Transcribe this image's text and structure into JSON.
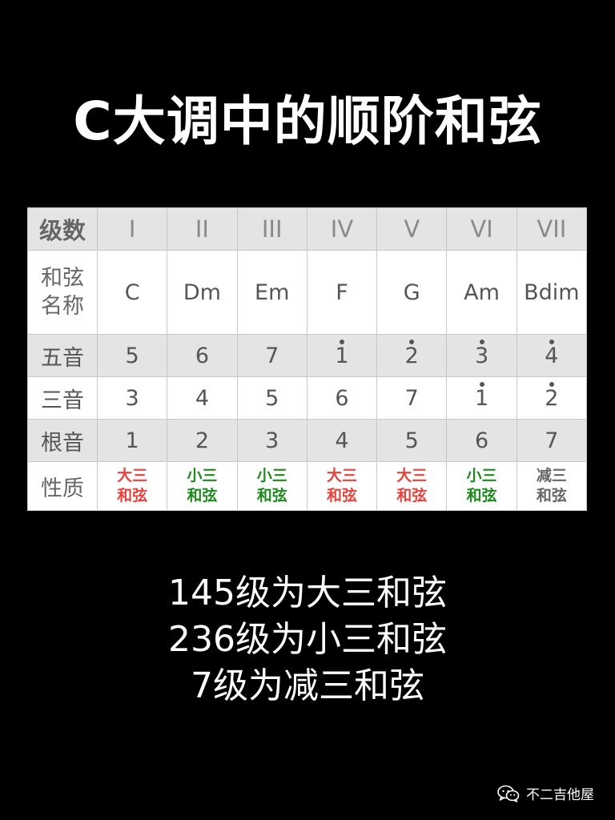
{
  "title": "C大调中的顺阶和弦",
  "table": {
    "header_label": "级数",
    "degrees": [
      "I",
      "II",
      "III",
      "IV",
      "V",
      "VI",
      "VII"
    ],
    "chord_name_label_line1": "和弦",
    "chord_name_label_line2": "名称",
    "chord_names": [
      "C",
      "Dm",
      "Em",
      "F",
      "G",
      "Am",
      "Bdim"
    ],
    "fifth_label": "五音",
    "fifths": [
      {
        "value": "5",
        "high": false
      },
      {
        "value": "6",
        "high": false
      },
      {
        "value": "7",
        "high": false
      },
      {
        "value": "1",
        "high": true
      },
      {
        "value": "2",
        "high": true
      },
      {
        "value": "3",
        "high": true
      },
      {
        "value": "4",
        "high": true
      }
    ],
    "third_label": "三音",
    "thirds": [
      {
        "value": "3",
        "high": false
      },
      {
        "value": "4",
        "high": false
      },
      {
        "value": "5",
        "high": false
      },
      {
        "value": "6",
        "high": false
      },
      {
        "value": "7",
        "high": false
      },
      {
        "value": "1",
        "high": true
      },
      {
        "value": "2",
        "high": true
      }
    ],
    "root_label": "根音",
    "roots": [
      "1",
      "2",
      "3",
      "4",
      "5",
      "6",
      "7"
    ],
    "quality_label": "性质",
    "qualities": [
      {
        "line1": "大三",
        "line2": "和弦",
        "color": "#e8423c"
      },
      {
        "line1": "小三",
        "line2": "和弦",
        "color": "#1e8a1e"
      },
      {
        "line1": "小三",
        "line2": "和弦",
        "color": "#1e8a1e"
      },
      {
        "line1": "大三",
        "line2": "和弦",
        "color": "#e8423c"
      },
      {
        "line1": "大三",
        "line2": "和弦",
        "color": "#e8423c"
      },
      {
        "line1": "小三",
        "line2": "和弦",
        "color": "#1e8a1e"
      },
      {
        "line1": "减三",
        "line2": "和弦",
        "color": "#666666"
      }
    ]
  },
  "summary": {
    "line1": "145级为大三和弦",
    "line2": "236级为小三和弦",
    "line3": "7级为减三和弦"
  },
  "watermark": {
    "icon": "wechat-icon",
    "text": "不二吉他屋"
  }
}
